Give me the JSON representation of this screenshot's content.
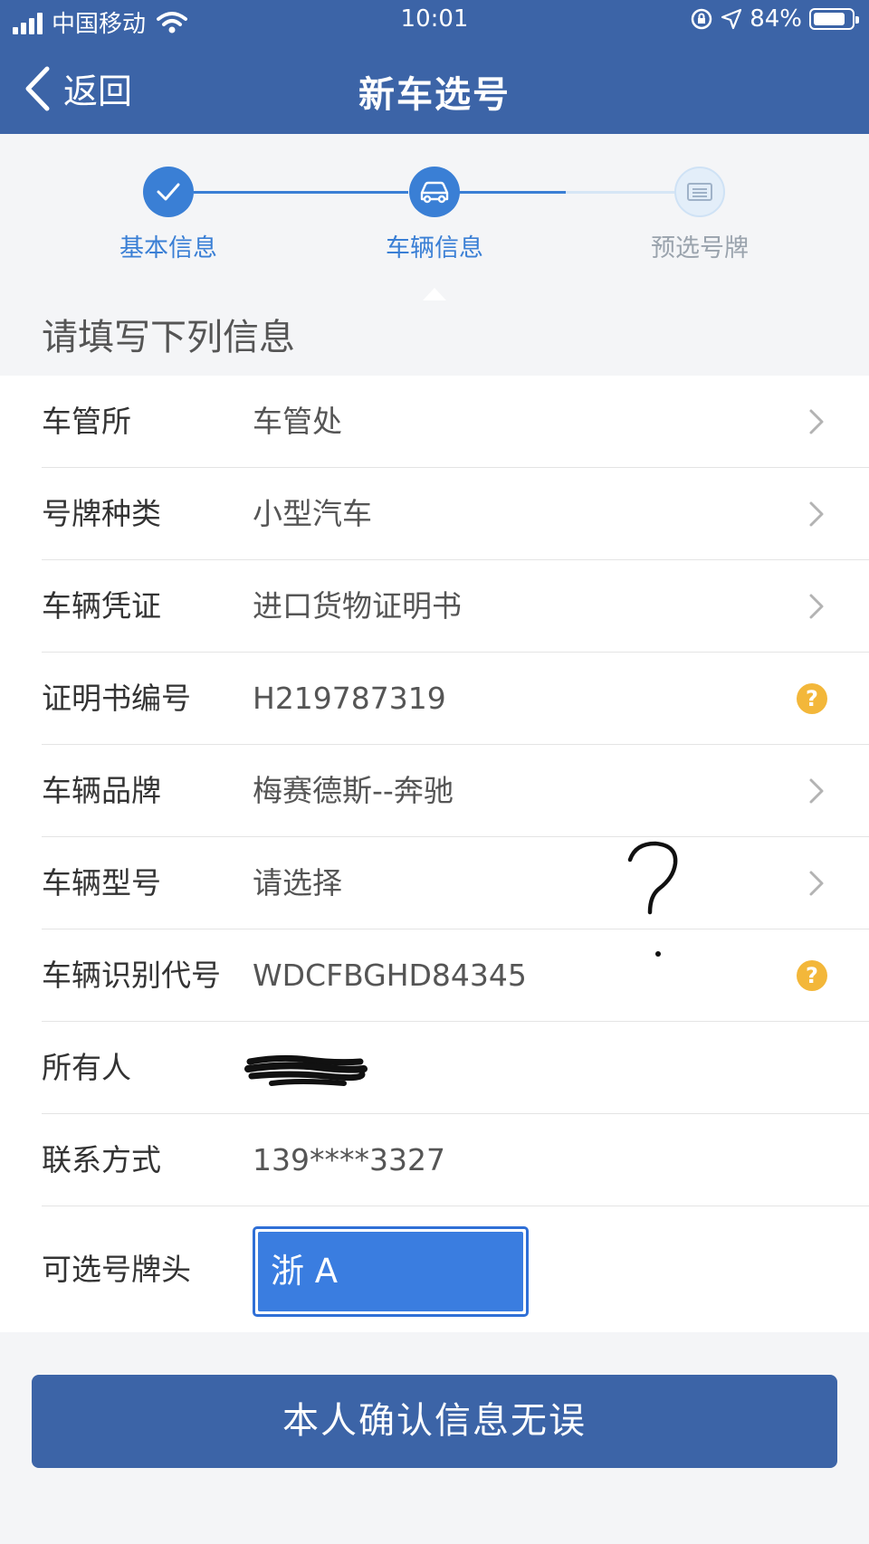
{
  "status_bar": {
    "carrier": "中国移动",
    "time": "10:01",
    "battery": "84%",
    "battery_level": 0.84
  },
  "nav": {
    "back_label": "返回",
    "title": "新车选号"
  },
  "stepper": {
    "steps": [
      {
        "label": "基本信息",
        "state": "done",
        "icon": "check-icon"
      },
      {
        "label": "车辆信息",
        "state": "active",
        "icon": "car-icon"
      },
      {
        "label": "预选号牌",
        "state": "pending",
        "icon": "license-plate-icon"
      }
    ],
    "colors": {
      "active": "#3a7fd5",
      "pending": "#cfe2f5",
      "pending_text": "#9aa3ad"
    }
  },
  "section_title": "请填写下列信息",
  "form": {
    "rows": [
      {
        "label": "车管所",
        "value": "车管处",
        "trailing": "chevron-right-icon"
      },
      {
        "label": "号牌种类",
        "value": "小型汽车",
        "trailing": "chevron-right-icon"
      },
      {
        "label": "车辆凭证",
        "value": "进口货物证明书",
        "trailing": "chevron-right-icon"
      },
      {
        "label": "证明书编号",
        "value": "H219787319",
        "trailing": "help-icon"
      },
      {
        "label": "车辆品牌",
        "value": "梅赛德斯--奔驰",
        "trailing": "chevron-right-icon"
      },
      {
        "label": "车辆型号",
        "value": "请选择",
        "trailing": "chevron-right-icon"
      },
      {
        "label": "车辆识别代号",
        "value": "WDCFBGHD84345",
        "trailing": "help-icon"
      },
      {
        "label": "所有人",
        "value": "",
        "trailing": "none"
      },
      {
        "label": "联系方式",
        "value": "139****3327",
        "trailing": "none"
      }
    ],
    "plate_prefix": {
      "label": "可选号牌头",
      "value": "浙 A"
    }
  },
  "help_symbol": "?",
  "confirm_button_label": "本人确认信息无误",
  "colors": {
    "header": "#3c64a7",
    "help_badge": "#f3b73a",
    "select_fill": "#3a7de0"
  }
}
